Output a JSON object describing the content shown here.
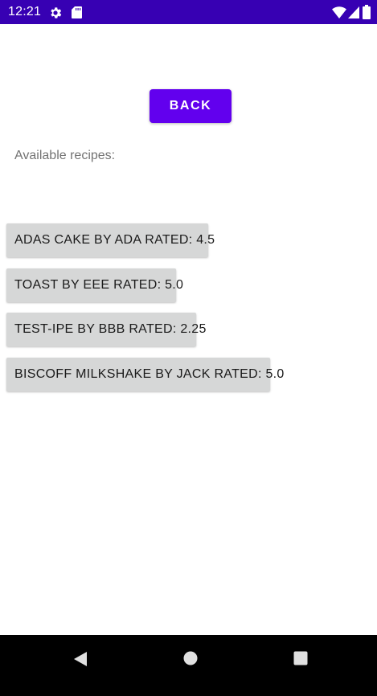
{
  "status_bar": {
    "time": "12:21",
    "background_color": "#3700b3",
    "icons": [
      "gear-icon",
      "sd-card-icon",
      "wifi-icon",
      "signal-icon",
      "battery-icon"
    ]
  },
  "header": {
    "back_label": "BACK",
    "accent_color": "#6200ee"
  },
  "main": {
    "section_label": "Available recipes:",
    "recipes": [
      {
        "label": "ADAS CAKE BY ADA RATED: 4.5"
      },
      {
        "label": "TOAST BY EEE RATED: 5.0"
      },
      {
        "label": "TEST-IPE BY BBB RATED: 2.25"
      },
      {
        "label": "BISCOFF MILKSHAKE BY JACK RATED: 5.0"
      }
    ]
  },
  "nav_bar": {
    "icons": [
      "nav-back-icon",
      "nav-home-icon",
      "nav-recents-icon"
    ]
  }
}
